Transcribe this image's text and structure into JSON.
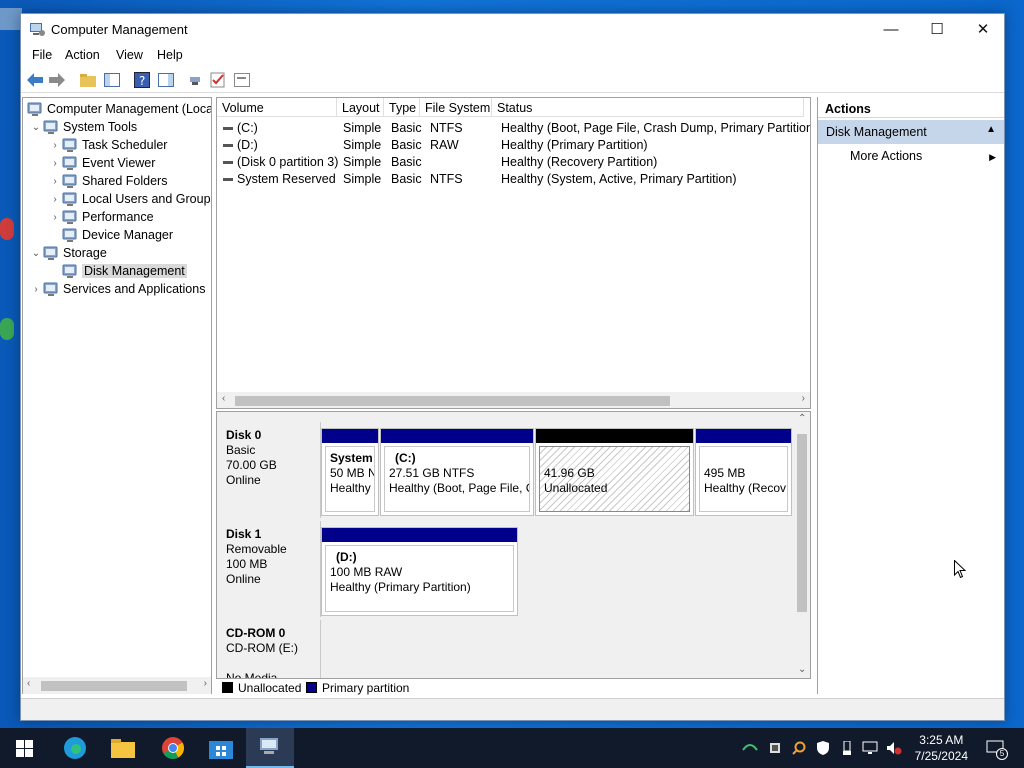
{
  "window": {
    "title": "Computer Management",
    "controls": {
      "minimize": "—",
      "maximize": "☐",
      "close": "✕"
    }
  },
  "menu": [
    "File",
    "Action",
    "View",
    "Help"
  ],
  "tree": [
    {
      "label": "Computer Management (Local",
      "expander": "",
      "level": 0,
      "icon": "computer-management-icon"
    },
    {
      "label": "System Tools",
      "expander": "⌄",
      "level": 1,
      "icon": "system-tools-icon"
    },
    {
      "label": "Task Scheduler",
      "expander": "›",
      "level": 2,
      "icon": "task-scheduler-icon"
    },
    {
      "label": "Event Viewer",
      "expander": "›",
      "level": 2,
      "icon": "event-viewer-icon"
    },
    {
      "label": "Shared Folders",
      "expander": "›",
      "level": 2,
      "icon": "shared-folders-icon"
    },
    {
      "label": "Local Users and Groups",
      "expander": "›",
      "level": 2,
      "icon": "local-users-icon"
    },
    {
      "label": "Performance",
      "expander": "›",
      "level": 2,
      "icon": "performance-icon"
    },
    {
      "label": "Device Manager",
      "expander": "",
      "level": 2,
      "icon": "device-manager-icon"
    },
    {
      "label": "Storage",
      "expander": "⌄",
      "level": 1,
      "icon": "storage-icon"
    },
    {
      "label": "Disk Management",
      "expander": "",
      "level": 2,
      "icon": "disk-management-icon",
      "selected": true
    },
    {
      "label": "Services and Applications",
      "expander": "›",
      "level": 1,
      "icon": "services-icon"
    }
  ],
  "volumes": {
    "columns": [
      "Volume",
      "Layout",
      "Type",
      "File System",
      "Status"
    ],
    "rows": [
      [
        "(C:)",
        "Simple",
        "Basic",
        "NTFS",
        "Healthy (Boot, Page File, Crash Dump, Primary Partition)"
      ],
      [
        "(D:)",
        "Simple",
        "Basic",
        "RAW",
        "Healthy (Primary Partition)"
      ],
      [
        "(Disk 0 partition 3)",
        "Simple",
        "Basic",
        "",
        "Healthy (Recovery Partition)"
      ],
      [
        "System Reserved",
        "Simple",
        "Basic",
        "NTFS",
        "Healthy (System, Active, Primary Partition)"
      ]
    ]
  },
  "disks": [
    {
      "name": "Disk 0",
      "type": "Basic",
      "size": "70.00 GB",
      "state": "Online",
      "partitions": [
        {
          "title": "System",
          "size": "50 MB N",
          "status": "Healthy",
          "kind": "primary"
        },
        {
          "title": "(C:)",
          "size": "27.51 GB NTFS",
          "status": "Healthy (Boot, Page File, C",
          "kind": "primary"
        },
        {
          "title": "",
          "size": "41.96 GB",
          "status": "Unallocated",
          "kind": "unallocated"
        },
        {
          "title": "",
          "size": "495 MB",
          "status": "Healthy (Recov",
          "kind": "primary"
        }
      ]
    },
    {
      "name": "Disk 1",
      "type": "Removable",
      "size": "100 MB",
      "state": "Online",
      "partitions": [
        {
          "title": "(D:)",
          "size": "100 MB RAW",
          "status": "Healthy (Primary Partition)",
          "kind": "primary"
        }
      ]
    },
    {
      "name": "CD-ROM 0",
      "type": "CD-ROM (E:)",
      "size": "",
      "state": "No Media",
      "partitions": []
    }
  ],
  "legend": {
    "unallocated": "Unallocated",
    "primary": "Primary partition"
  },
  "actions": {
    "header": "Actions",
    "section": "Disk Management",
    "item": "More Actions"
  },
  "clock": {
    "time": "3:25 AM",
    "date": "7/25/2024"
  },
  "notification_count": "5",
  "colors": {
    "primary": "#00008b",
    "unallocated": "#000000",
    "selection": "#c5d6ea"
  }
}
